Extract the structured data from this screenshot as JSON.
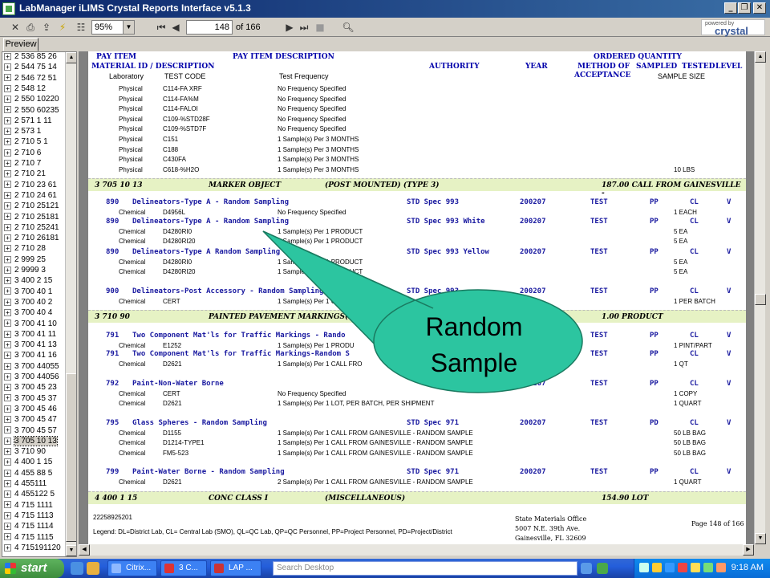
{
  "window": {
    "title": "LabManager iLIMS Crystal Reports Interface v5.1.3",
    "min_label": "_",
    "restore_label": "❐",
    "close_label": "✕"
  },
  "toolbar": {
    "zoom": "95%",
    "page_current": "148",
    "page_of": "of 166",
    "powered_line1": "powered by",
    "powered_line2": "crystal"
  },
  "tab": {
    "preview": "Preview"
  },
  "tree": [
    "2 536 85 26",
    "2 544 75 14",
    "2 546 72 51",
    "2 548 12",
    "2 550 10220",
    "2 550 60235",
    "2 571  1 11",
    "2 573  1",
    "2 710  5  1",
    "2 710  6",
    "2 710  7",
    "2 710 21",
    "2 710 23 61",
    "2 710 24 61",
    "2 710 25121",
    "2 710 25181",
    "2 710 25241",
    "2 710 26181",
    "2 710 28",
    "2 999 25",
    "2 9999  3",
    "3 400  2 15",
    "3 700 40  1",
    "3 700 40  2",
    "3 700 40  4",
    "3 700 41 10",
    "3 700 41 11",
    "3 700 41 13",
    "3 700 41 16",
    "3 700 44055",
    "3 700 44056",
    "3 700 45 23",
    "3 700 45 37",
    "3 700 45 46",
    "3 700 45 47",
    "3 700 45 57",
    "3 705 10 13",
    "3 710 90",
    "4 400  1 15",
    "4 455 88  5",
    "4 455111",
    "4 455122  5",
    "4 715  1111",
    "4 715  1113",
    "4 715  1114",
    "4 715  1115",
    "4 715191120"
  ],
  "tree_selected_index": 36,
  "report": {
    "header1": {
      "pay_item": "PAY ITEM",
      "pay_item_desc": "PAY ITEM DESCRIPTION",
      "ordered_qty": "ORDERED QUANTITY"
    },
    "header2": {
      "material": "MATERIAL ID / DESCRIPTION",
      "authority": "AUTHORITY",
      "year": "YEAR",
      "method1": "METHOD OF",
      "method2": "ACCEPTANCE",
      "sampled": "SAMPLED",
      "tested": "TESTED",
      "level": "LEVEL"
    },
    "header3": {
      "laboratory": "Laboratory",
      "test_code": "TEST CODE",
      "test_freq": "Test Frequency",
      "sample_size": "SAMPLE SIZE"
    },
    "top_lines": [
      [
        "Physical",
        "C114-FA XRF",
        "No Frequency Specified",
        ""
      ],
      [
        "Physical",
        "C114-FA%M",
        "No Frequency Specified",
        ""
      ],
      [
        "Physical",
        "C114-FALOI",
        "No Frequency Specified",
        ""
      ],
      [
        "Physical",
        "C109-%STD28F",
        "No Frequency Specified",
        ""
      ],
      [
        "Physical",
        "C109-%STD7F",
        "No Frequency Specified",
        ""
      ],
      [
        "Physical",
        "C151",
        "1  Sample(s) Per  3   MONTHS",
        ""
      ],
      [
        "Physical",
        "C188",
        "1  Sample(s) Per  3   MONTHS",
        ""
      ],
      [
        "Physical",
        "C430FA",
        "1  Sample(s) Per  3   MONTHS",
        ""
      ],
      [
        "Physical",
        "C618-%H2O",
        "1  Sample(s) Per  3   MONTHS",
        "10 LBS"
      ]
    ],
    "band1": {
      "code": "3 705 10 13",
      "desc": "MARKER OBJECT",
      "type": "(POST MOUNTED)   (TYPE 3)",
      "qty": "187.00  CALL FROM GAINESVILLE -"
    },
    "items_a": [
      {
        "num": "890",
        "name": "Delineators-Type A - Random Sampling",
        "auth": "STD Spec 993",
        "year": "200207",
        "method": "TEST",
        "s": "PP",
        "t": "CL",
        "l": "V",
        "lines": [
          [
            "Chemical",
            "D4956L",
            "No Frequency Specified",
            "1 EACH"
          ]
        ]
      },
      {
        "num": "890",
        "name": "Delineators-Type A - Random Sampling",
        "auth": "STD Spec 993 White",
        "year": "200207",
        "method": "TEST",
        "s": "PP",
        "t": "CL",
        "l": "V",
        "lines": [
          [
            "Chemical",
            "D4280RI0",
            "1  Sample(s) Per  1   PRODUCT",
            "5 EA"
          ],
          [
            "Chemical",
            "D4280RI20",
            "1  Sample(s) Per  1   PRODUCT",
            "5 EA"
          ]
        ]
      },
      {
        "num": "890",
        "name": "Delineators-Type A Random Sampling",
        "auth": "STD Spec 993 Yellow",
        "year": "200207",
        "method": "TEST",
        "s": "PP",
        "t": "CL",
        "l": "V",
        "lines": [
          [
            "Chemical",
            "D4280RI0",
            "1  Sample(s) Per  1   PRODUCT",
            "5 EA"
          ],
          [
            "Chemical",
            "D4280RI20",
            "1  Sample(s) Per  1   PRODUCT",
            "5 EA"
          ]
        ]
      },
      {
        "num": "900",
        "name": "Delineators-Post Accessory - Random Sampling",
        "auth": "STD Spec 993",
        "year": "200207",
        "method": "TEST",
        "s": "PP",
        "t": "CL",
        "l": "V",
        "lines": [
          [
            "Chemical",
            "CERT",
            "1  Sample(s) Per  1   CALL FROM",
            "1 PER BATCH"
          ]
        ]
      }
    ],
    "band2": {
      "code": "3 710 90",
      "desc": "PAINTED PAVEMENT MARKINGS(FINAL SURF",
      "type": "",
      "qty": "1.00  PRODUCT"
    },
    "items_b": [
      {
        "num": "791",
        "name": "Two Component Mat'ls for Traffic Markings - Rando",
        "auth": "",
        "year": "",
        "method": "TEST",
        "s": "PP",
        "t": "CL",
        "l": "V",
        "lines": [
          [
            "Chemical",
            "E1252",
            "1  Sample(s) Per  1   PRODU",
            "1 PINT/PART"
          ]
        ]
      },
      {
        "num": "791",
        "name": "Two Component Mat'ls for Traffic Markings-Random S",
        "auth": "",
        "year": "",
        "method": "TEST",
        "s": "PP",
        "t": "CL",
        "l": "V",
        "lines": [
          [
            "Chemical",
            "D2621",
            "1  Sample(s) Per  1   CALL FRO",
            "1 QT"
          ]
        ]
      },
      {
        "num": "792",
        "name": "Paint-Non-Water Borne",
        "auth": "",
        "year": "200207",
        "method": "TEST",
        "s": "PP",
        "t": "CL",
        "l": "V",
        "lines": [
          [
            "Chemical",
            "CERT",
            "No Frequency Specified",
            "1 COPY"
          ],
          [
            "Chemical",
            "D2621",
            "1  Sample(s) Per  1   LOT, PER BATCH, PER SHIPMENT",
            "1 QUART"
          ]
        ]
      },
      {
        "num": "795",
        "name": "Glass Spheres - Random Sampling",
        "auth": "STD Spec 971",
        "year": "200207",
        "method": "TEST",
        "s": "PD",
        "t": "CL",
        "l": "V",
        "lines": [
          [
            "Chemical",
            "D1155",
            "1  Sample(s) Per  1   CALL FROM GAINESVILLE - RANDOM SAMPLE",
            "50 LB BAG"
          ],
          [
            "Chemical",
            "D1214-TYPE1",
            "1  Sample(s) Per  1   CALL FROM GAINESVILLE - RANDOM SAMPLE",
            "50 LB BAG"
          ],
          [
            "Chemical",
            "FM5-523",
            "1  Sample(s) Per  1   CALL FROM GAINESVILLE - RANDOM SAMPLE",
            "50 LB BAG"
          ]
        ]
      },
      {
        "num": "799",
        "name": "Paint-Water Borne - Random Sampling",
        "auth": "STD Spec 971",
        "year": "200207",
        "method": "TEST",
        "s": "PP",
        "t": "CL",
        "l": "V",
        "lines": [
          [
            "Chemical",
            "D2621",
            "2  Sample(s) Per  1   CALL FROM GAINESVILLE - RANDOM SAMPLE",
            "1 QUART"
          ]
        ]
      }
    ],
    "band3": {
      "code": "4 400  1 15",
      "desc": "CONC CLASS I",
      "type": "(MISCELLANEOUS)",
      "qty": "154.90  LOT"
    },
    "footer": {
      "id": "22258925201",
      "legend": "Legend: DL=District Lab, CL= Central Lab (SMO), QL=QC Lab, QP=QC Personnel, PP=Project Personnel, PD=Project/District",
      "office1": "State Materials Office",
      "office2": "5007 N.E. 39th Ave.",
      "office3": "Gainesville, FL  32609",
      "page": "Page 148 of 166"
    }
  },
  "callout": {
    "line1": "Random",
    "line2": "Sample"
  },
  "taskbar": {
    "start": "start",
    "tasks": [
      "Citrix...",
      "3 C...",
      "LAP ..."
    ],
    "search_placeholder": "Search Desktop",
    "clock": "9:18 AM"
  }
}
